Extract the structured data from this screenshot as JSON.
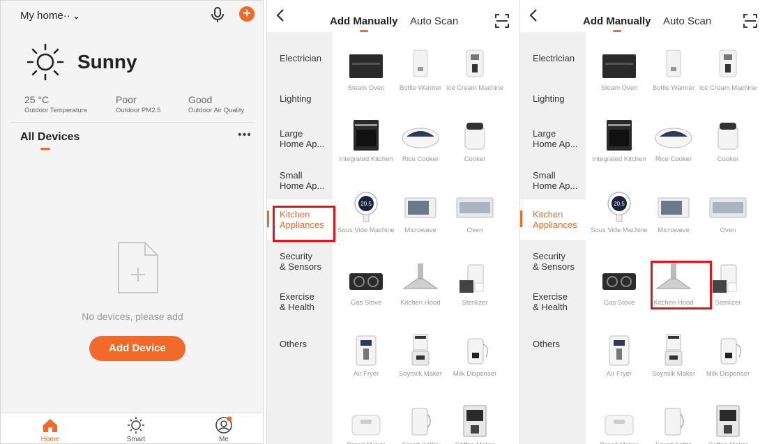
{
  "home": {
    "home_name": "My home",
    "home_name_suffix": "··",
    "weather": "Sunny",
    "stats": [
      {
        "value": "25 °C",
        "label": "Outdoor Temperature"
      },
      {
        "value": "Poor",
        "label": "Outdoor PM2.5"
      },
      {
        "value": "Good",
        "label": "Outdoor Air Quality"
      }
    ],
    "all_devices": "All Devices",
    "empty_text": "No devices, please add",
    "add_device": "Add Device",
    "tabs": [
      {
        "label": "Home",
        "icon": "home-icon"
      },
      {
        "label": "Smart",
        "icon": "smart-sun-icon"
      },
      {
        "label": "Me",
        "icon": "me-icon"
      }
    ],
    "accent": "#f26a2a"
  },
  "add": {
    "tab_manual": "Add Manually",
    "tab_auto": "Auto Scan",
    "categories": [
      "Electrician",
      "Lighting",
      "Large\nHome Ap...",
      "Small\nHome Ap...",
      "Kitchen\nAppliances",
      "Security\n& Sensors",
      "Exercise\n& Health",
      "Others"
    ],
    "selected_category": "Kitchen Appliances",
    "items": [
      {
        "label": "Steam Oven",
        "icon": "steam-oven-icon"
      },
      {
        "label": "Bottle Warmer",
        "icon": "bottle-warmer-icon"
      },
      {
        "label": "Ice Cream Machine",
        "icon": "ice-cream-machine-icon"
      },
      {
        "label": "Integrated Kitchen",
        "icon": "integrated-kitchen-icon"
      },
      {
        "label": "Rice Cooker",
        "icon": "rice-cooker-icon"
      },
      {
        "label": "Cooker",
        "icon": "cooker-icon"
      },
      {
        "label": "Sous Vide Machine",
        "icon": "sous-vide-icon",
        "display_value": "20.5"
      },
      {
        "label": "Microwave",
        "icon": "microwave-icon"
      },
      {
        "label": "Oven",
        "icon": "oven-icon"
      },
      {
        "label": "Gas Stove",
        "icon": "gas-stove-icon"
      },
      {
        "label": "Kitchen Hood",
        "icon": "kitchen-hood-icon"
      },
      {
        "label": "Sterilizer",
        "icon": "sterilizer-icon"
      },
      {
        "label": "Air Fryer",
        "icon": "air-fryer-icon"
      },
      {
        "label": "Soymilk Maker",
        "icon": "soymilk-maker-icon"
      },
      {
        "label": "Milk Dispenser",
        "icon": "milk-dispenser-icon"
      },
      {
        "label": "Bread Maker",
        "icon": "bread-maker-icon"
      },
      {
        "label": "Smart Kettle",
        "icon": "smart-kettle-icon"
      },
      {
        "label": "Coffee Maker",
        "icon": "coffee-maker-icon"
      }
    ],
    "highlight_color": "#e0141a"
  }
}
